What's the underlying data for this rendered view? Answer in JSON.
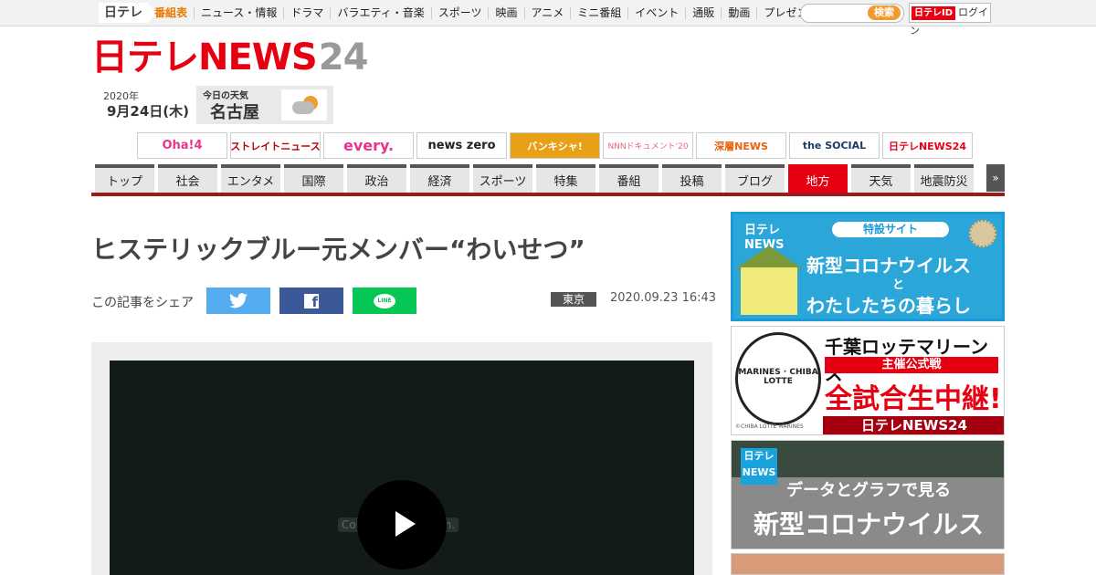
{
  "topbar": {
    "home": "日テレ",
    "nav": [
      "番組表",
      "ニュース・情報",
      "ドラマ",
      "バラエティ・音楽",
      "スポーツ",
      "映画",
      "アニメ",
      "ミニ番組",
      "イベント",
      "通販",
      "動画",
      "プレゼント"
    ],
    "search_button": "検索",
    "login_badge": "日テレID",
    "login_label": "ログイン"
  },
  "header": {
    "logo_main": "日テレNEWS",
    "logo_num": "24",
    "year": "2020年",
    "date": "9月24日(木)",
    "weather_label": "今日の天気",
    "weather_city": "名古屋"
  },
  "programs": [
    "Oha!4",
    "ストレイトニュース",
    "every.",
    "news zero",
    "バンキシャ!",
    "NNNドキュメント'20",
    "深層NEWS",
    "the SOCIAL",
    "日テレNEWS24"
  ],
  "categories": [
    "トップ",
    "社会",
    "エンタメ",
    "国際",
    "政治",
    "経済",
    "スポーツ",
    "特集",
    "番組",
    "投稿",
    "ブログ",
    "地方",
    "天気",
    "地震防災"
  ],
  "nav_more": "»",
  "article": {
    "title": "ヒステリックブルー元メンバー“わいせつ”",
    "share_label": "この記事をシェア",
    "share_line": "LINE",
    "location": "東京",
    "datetime": "2020.09.23 16:43",
    "video_error": "Couldn't load plugin."
  },
  "sidebar": {
    "corona": {
      "brand_top": "日テレ",
      "brand_bottom": "NEWS",
      "tag": "特設サイト",
      "line1": "新型コロナウイルス",
      "line2": "と",
      "line3": "わたしたちの暮らし"
    },
    "marines": {
      "emblem": "MARINES · CHIBA LOTTE",
      "copyright": "©CHIBA LOTTE MARINES",
      "title": "千葉ロッテマリーンズ",
      "sub": "主催公式戦",
      "main": "全試合生中継!",
      "footer": "日テレNEWS24"
    },
    "data": {
      "badge_top": "日テレ",
      "badge_bottom": "NEWS",
      "line1": "データとグラフで見る",
      "line2": "新型コロナウイルス"
    }
  }
}
